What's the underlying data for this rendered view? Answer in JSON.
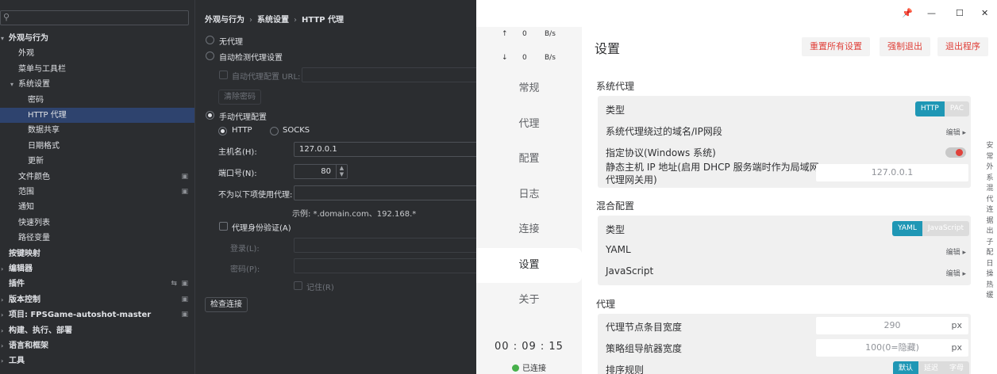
{
  "ide": {
    "search_placeholder": "",
    "tree": [
      {
        "label": "外观与行为",
        "bold": true,
        "arrow": "▾"
      },
      {
        "label": "外观"
      },
      {
        "label": "菜单与工具栏"
      },
      {
        "label": "系统设置",
        "arrow": "▾"
      },
      {
        "label": "密码"
      },
      {
        "label": "HTTP 代理",
        "selected": true
      },
      {
        "label": "数据共享"
      },
      {
        "label": "日期格式"
      },
      {
        "label": "更新"
      },
      {
        "label": "文件颜色"
      },
      {
        "label": "范围"
      },
      {
        "label": "通知"
      },
      {
        "label": "快速列表"
      },
      {
        "label": "路径变量"
      },
      {
        "label": "按键映射",
        "bold": true
      },
      {
        "label": "编辑器",
        "bold": true,
        "arrow": "›"
      },
      {
        "label": "插件",
        "bold": true
      },
      {
        "label": "版本控制",
        "bold": true,
        "arrow": "›"
      },
      {
        "label": "项目: FPSGame-autoshot-master",
        "bold": true,
        "arrow": "›"
      },
      {
        "label": "构建、执行、部署",
        "bold": true,
        "arrow": "›"
      },
      {
        "label": "语言和框架",
        "bold": true,
        "arrow": "›"
      },
      {
        "label": "工具",
        "bold": true,
        "arrow": "›"
      }
    ],
    "breadcrumb": [
      "外观与行为",
      "系统设置",
      "HTTP 代理"
    ],
    "proxy": {
      "no_proxy": "无代理",
      "auto_detect": "自动检测代理设置",
      "auto_config_url": "自动代理配置 URL:",
      "clear_password": "清除密码",
      "manual": "手动代理配置",
      "http": "HTTP",
      "socks": "SOCKS",
      "host_label": "主机名(H):",
      "host_value": "127.0.0.1",
      "port_label": "端口号(N):",
      "port_value": "80",
      "no_proxy_for": "不为以下项使用代理:",
      "example": "示例: *.domain.com、192.168.*",
      "auth": "代理身份验证(A)",
      "login": "登录(L):",
      "password": "密码(P):",
      "remember": "记住(R)",
      "check_connection": "检查连接"
    }
  },
  "clash": {
    "titlebar": {
      "pin": "📌",
      "minimize": "—",
      "maximize": "☐",
      "close": "✕"
    },
    "speed_up": {
      "arrow": "↑",
      "value": "0",
      "unit": "B/s"
    },
    "speed_down": {
      "arrow": "↓",
      "value": "0",
      "unit": "B/s"
    },
    "nav": [
      "常规",
      "代理",
      "配置",
      "日志",
      "连接",
      "设置",
      "关于"
    ],
    "active_nav": "设置",
    "timer": "00 : 09 : 15",
    "connection_status": "已连接",
    "main": {
      "title": "设置",
      "buttons": [
        "重置所有设置",
        "强制退出",
        "退出程序"
      ],
      "system_proxy": {
        "title": "系统代理",
        "type_label": "类型",
        "type_options": [
          "HTTP",
          "PAC"
        ],
        "type_selected": "HTTP",
        "bypass_label": "系统代理绕过的域名/IP网段",
        "edit": "编辑 ▸",
        "protocol_label": "指定协议(Windows 系统)",
        "static_ip_label_1": "静态主机 IP 地址(启用 DHCP 服务端时作为局域网",
        "static_ip_label_2": "代理网关用)",
        "static_ip_value": "127.0.0.1"
      },
      "mixin": {
        "title": "混合配置",
        "type_label": "类型",
        "type_options": [
          "YAML",
          "JavaScript"
        ],
        "type_selected": "YAML",
        "yaml_label": "YAML",
        "js_label": "JavaScript",
        "edit": "编辑 ▸"
      },
      "proxy": {
        "title": "代理",
        "item_width_label": "代理节点条目宽度",
        "item_width_value": "290",
        "item_width_unit": "px",
        "nav_width_label": "策略组导航器宽度",
        "nav_width_value": "100(0=隐藏)",
        "nav_width_unit": "px",
        "sort_label": "排序规则",
        "sort_options": [
          "默认",
          "延迟",
          "字母"
        ],
        "sort_selected": "默认"
      },
      "side_text": "安常外系混代连据出子配日操热缓"
    }
  },
  "colors": {
    "accent": "#1f97b5",
    "danger": "#e0423b",
    "connected": "#47b04b",
    "ide_bg": "#2b2d30",
    "ide_selected": "#2e436e"
  }
}
